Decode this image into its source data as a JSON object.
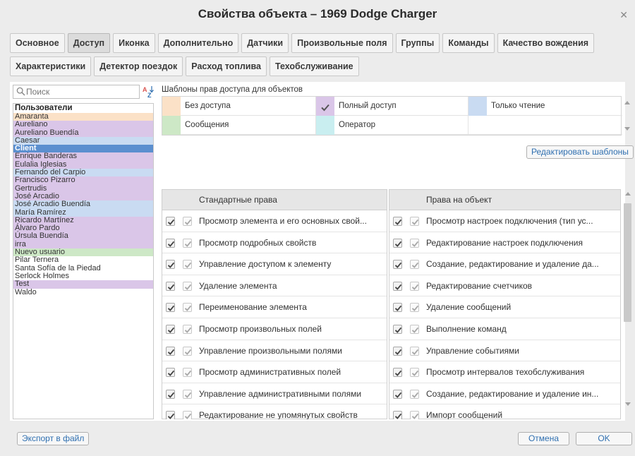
{
  "window": {
    "title": "Свойства объекта – 1969 Dodge Charger"
  },
  "tabs_row1": [
    {
      "label": "Основное"
    },
    {
      "label": "Доступ",
      "active": true
    },
    {
      "label": "Иконка"
    },
    {
      "label": "Дополнительно"
    },
    {
      "label": "Датчики"
    },
    {
      "label": "Произвольные поля"
    },
    {
      "label": "Группы"
    },
    {
      "label": "Команды"
    },
    {
      "label": "Качество вождения"
    }
  ],
  "tabs_row2": [
    {
      "label": "Характеристики"
    },
    {
      "label": "Детектор поездок"
    },
    {
      "label": "Расход топлива"
    },
    {
      "label": "Техобслуживание"
    }
  ],
  "search": {
    "placeholder": "Поиск"
  },
  "users": {
    "group_label": "Пользователи",
    "items": [
      {
        "name": "Amaranta",
        "color": "#fbe1c7"
      },
      {
        "name": "Aureliano",
        "color": "#dac6e8"
      },
      {
        "name": "Aureliano Buendía",
        "color": "#dac6e8"
      },
      {
        "name": "Caesar",
        "color": "#c9dbf2"
      },
      {
        "name": "Client",
        "color": "#5b8fcf",
        "selected": true
      },
      {
        "name": "Enrique Banderas",
        "color": "#dac6e8"
      },
      {
        "name": "Eulalia Iglesias",
        "color": "#dac6e8"
      },
      {
        "name": "Fernando del Carpio",
        "color": "#c9dbf2"
      },
      {
        "name": "Francisco Pizarro",
        "color": "#dac6e8"
      },
      {
        "name": "Gertrudis",
        "color": "#dac6e8"
      },
      {
        "name": "José Arcadio",
        "color": "#dac6e8"
      },
      {
        "name": "José Arcadio Buendía",
        "color": "#c9dbf2"
      },
      {
        "name": "María Ramírez",
        "color": "#c9dbf2"
      },
      {
        "name": "Ricardo Martínez",
        "color": "#dac6e8"
      },
      {
        "name": "Álvaro Pardo",
        "color": "#dac6e8"
      },
      {
        "name": "Úrsula Buendía",
        "color": "#dac6e8"
      },
      {
        "name": "irra",
        "color": "#dac6e8"
      },
      {
        "name": "Nuevo usuario",
        "color": "#cde8c6"
      },
      {
        "name": "Pilar Ternera",
        "color": "#ffffff"
      },
      {
        "name": "Santa Sofía de la Piedad",
        "color": "#ffffff"
      },
      {
        "name": "Serlock Holmes",
        "color": "#ffffff"
      },
      {
        "name": "Test",
        "color": "#dac6e8"
      },
      {
        "name": "Waldo",
        "color": "#ffffff"
      }
    ]
  },
  "templates": {
    "label": "Шаблоны прав доступа для объектов",
    "items": [
      {
        "label": "Без доступа",
        "color": "#fbe1c7"
      },
      {
        "label": "Полный доступ",
        "color": "#dac6e8",
        "checked": true
      },
      {
        "label": "Только чтение",
        "color": "#c9dbf2"
      },
      {
        "label": "Сообщения",
        "color": "#cde8c6"
      },
      {
        "label": "Оператор",
        "color": "#c9eef0"
      }
    ],
    "edit_button": "Редактировать шаблоны"
  },
  "rights": {
    "standard_header": "Стандартные права",
    "object_header": "Права на объект",
    "standard": [
      "Просмотр элемента и его основных свой...",
      "Просмотр подробных свойств",
      "Управление доступом к элементу",
      "Удаление элемента",
      "Переименование элемента",
      "Просмотр произвольных полей",
      "Управление произвольными полями",
      "Просмотр административных полей",
      "Управление административными полями",
      "Редактирование не упомянутых свойств"
    ],
    "object": [
      "Просмотр настроек подключения (тип ус...",
      "Редактирование настроек подключения",
      "Создание, редактирование и удаление да...",
      "Редактирование счетчиков",
      "Удаление сообщений",
      "Выполнение команд",
      "Управление событиями",
      "Просмотр интервалов техобслуживания",
      "Создание, редактирование и удаление ин...",
      "Импорт сообщений"
    ]
  },
  "footer": {
    "export_label": "Экспорт в файл",
    "cancel_label": "Отмена",
    "ok_label": "OK"
  }
}
